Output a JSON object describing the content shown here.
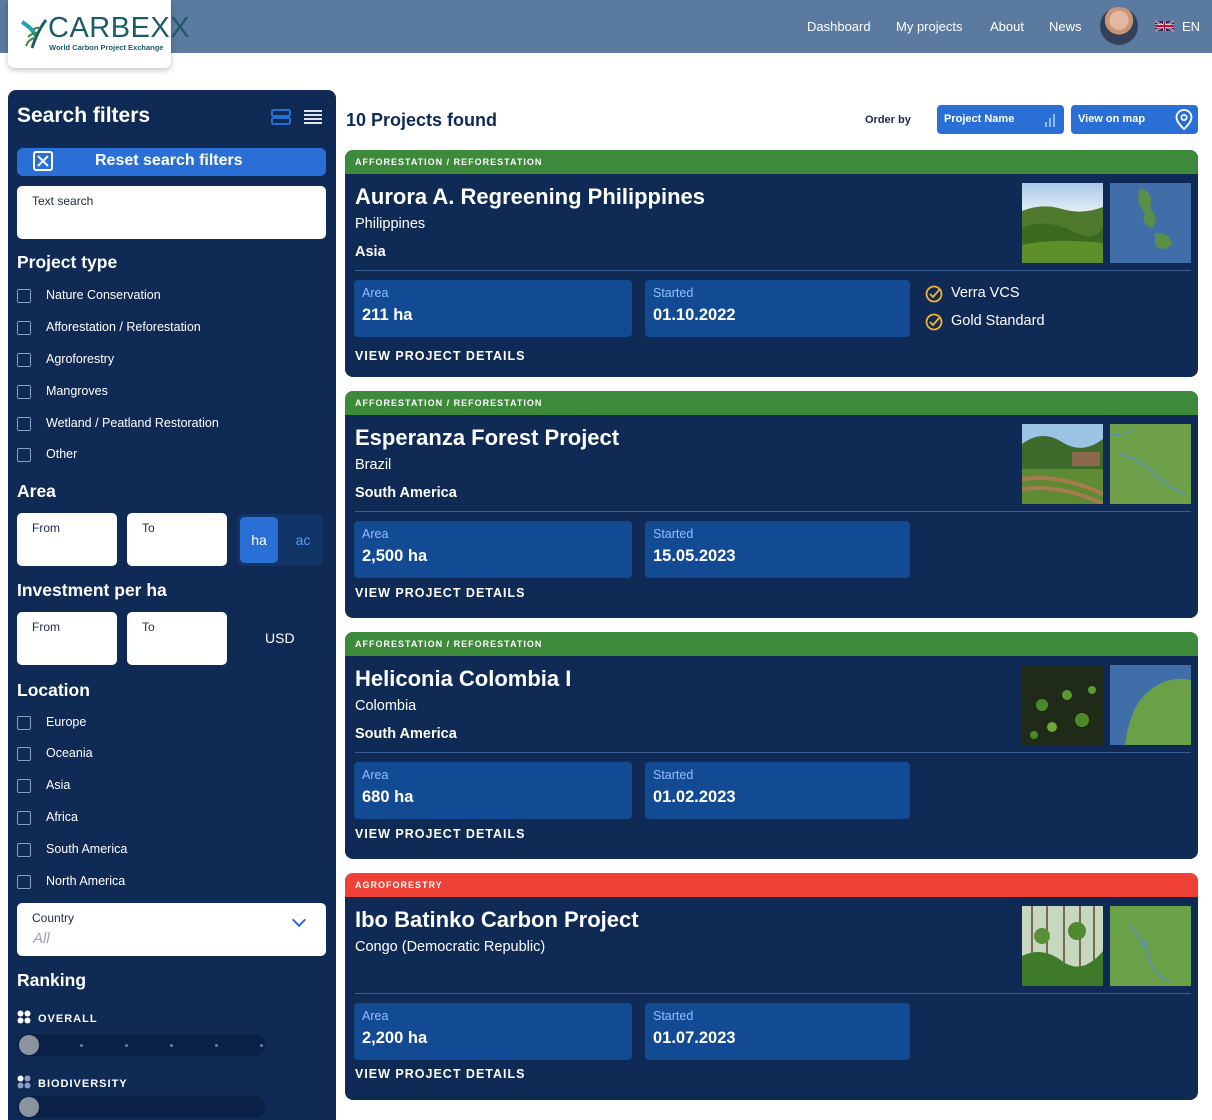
{
  "header": {
    "logo_title": "CARBEXX",
    "logo_subtitle": "World Carbon Project Exchange",
    "nav": [
      "Dashboard",
      "My projects",
      "About",
      "News"
    ],
    "language": "EN"
  },
  "sidebar": {
    "title": "Search filters",
    "reset_label": "Reset search filters",
    "text_search_label": "Text search",
    "project_type_title": "Project type",
    "project_types": [
      "Nature Conservation",
      "Afforestation / Reforestation",
      "Agroforestry",
      "Mangroves",
      "Wetland / Peatland Restoration",
      "Other"
    ],
    "area_title": "Area",
    "from_label": "From",
    "to_label": "To",
    "unit_ha": "ha",
    "unit_ac": "ac",
    "investment_title": "Investment per ha",
    "currency": "USD",
    "location_title": "Location",
    "locations": [
      "Europe",
      "Oceania",
      "Asia",
      "Africa",
      "South America",
      "North America"
    ],
    "country_label": "Country",
    "country_value": "All",
    "ranking_title": "Ranking",
    "ranking_overall": "OVERALL",
    "ranking_biodiversity": "BIODIVERSITY"
  },
  "results": {
    "count_text": "10 Projects found",
    "order_by": "Order by",
    "sort_label": "Project Name",
    "map_label": "View on map"
  },
  "labels": {
    "area": "Area",
    "started": "Started",
    "details": "VIEW PROJECT DETAILS"
  },
  "colors": {
    "navy": "#0e2a55",
    "accent_blue": "#2a6fd6",
    "afforestation_green": "#3c8a3a",
    "agroforestry_red": "#ef4135"
  },
  "projects": [
    {
      "category": "AFFORESTATION / REFORESTATION",
      "category_color": "#3c8a3a",
      "name": "Aurora A. Regreening Philippines",
      "country": "Philippines",
      "region": "Asia",
      "area": "211 ha",
      "started": "01.10.2022",
      "certifications": [
        "Verra VCS",
        "Gold Standard"
      ]
    },
    {
      "category": "AFFORESTATION / REFORESTATION",
      "category_color": "#3c8a3a",
      "name": "Esperanza Forest Project",
      "country": "Brazil",
      "region": "South America",
      "area": "2,500 ha",
      "started": "15.05.2023",
      "certifications": []
    },
    {
      "category": "AFFORESTATION / REFORESTATION",
      "category_color": "#3c8a3a",
      "name": "Heliconia Colombia I",
      "country": "Colombia",
      "region": "South America",
      "area": "680 ha",
      "started": "01.02.2023",
      "certifications": []
    },
    {
      "category": "AGROFORESTRY",
      "category_color": "#ef4135",
      "name": "Ibo Batinko Carbon Project",
      "country": "Congo (Democratic Republic)",
      "region": "",
      "area": "2,200 ha",
      "started": "01.07.2023",
      "certifications": []
    }
  ]
}
